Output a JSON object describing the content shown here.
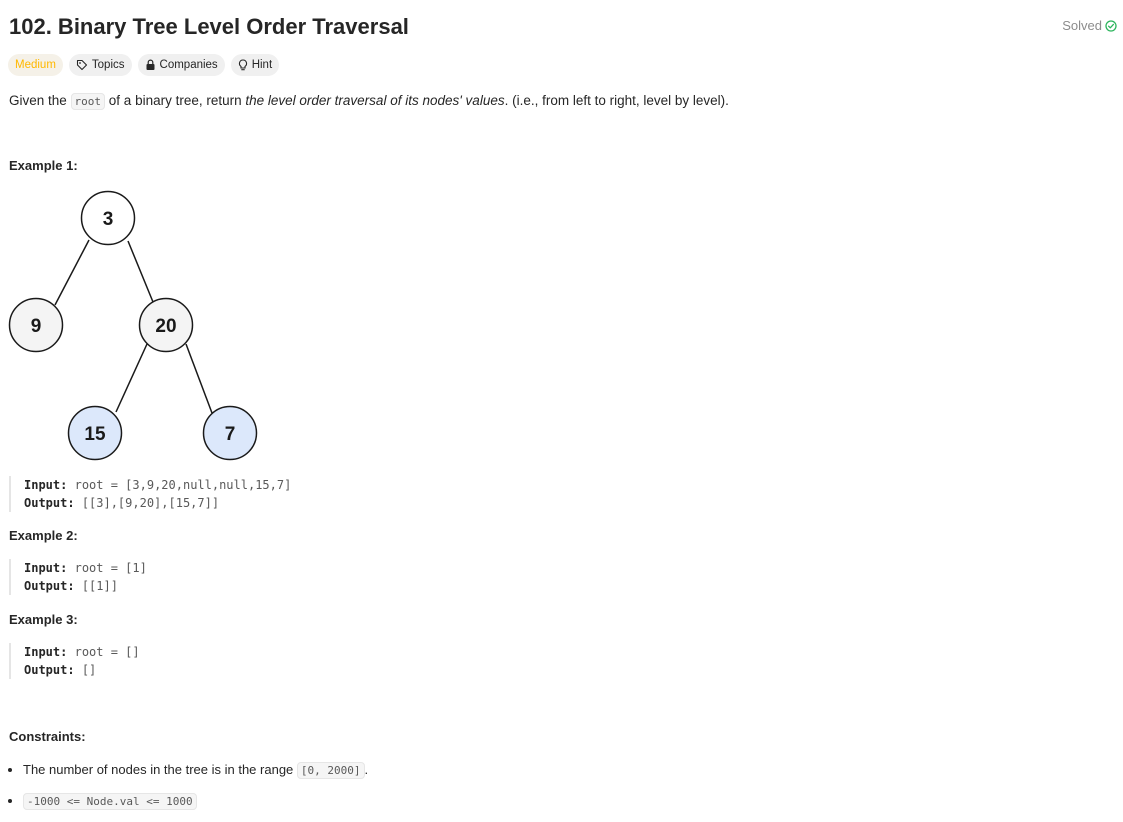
{
  "problem": {
    "title": "102. Binary Tree Level Order Traversal",
    "status": "Solved",
    "difficulty": "Medium",
    "tags": [
      "Topics",
      "Companies",
      "Hint"
    ]
  },
  "description": {
    "part1": "Given the ",
    "code": "root",
    "part2": " of a binary tree, return ",
    "emph": "the level order traversal of its nodes' values",
    "part3": ". (i.e., from left to right, level by level)."
  },
  "examples": [
    {
      "heading": "Example 1:",
      "input_label": "Input:",
      "input_value": "root = [3,9,20,null,null,15,7]",
      "output_label": "Output:",
      "output_value": "[[3],[9,20],[15,7]]"
    },
    {
      "heading": "Example 2:",
      "input_label": "Input:",
      "input_value": "root = [1]",
      "output_label": "Output:",
      "output_value": "[[1]]"
    },
    {
      "heading": "Example 3:",
      "input_label": "Input:",
      "input_value": "root = []",
      "output_label": "Output:",
      "output_value": "[]"
    }
  ],
  "tree": {
    "nodes": [
      "3",
      "9",
      "20",
      "15",
      "7"
    ],
    "colors": {
      "default_fill": "#f4f4f4",
      "highlight_fill": "#dce8fb",
      "stroke": "#1a1a1a"
    }
  },
  "constraints": {
    "heading": "Constraints:",
    "item1_text": "The number of nodes in the tree is in the range ",
    "item1_code": "[0, 2000]",
    "item1_end": ".",
    "item2_code": "-1000 <= Node.val <= 1000"
  },
  "colors": {
    "difficulty": "#ffb800",
    "solved_check": "#2db55d"
  }
}
